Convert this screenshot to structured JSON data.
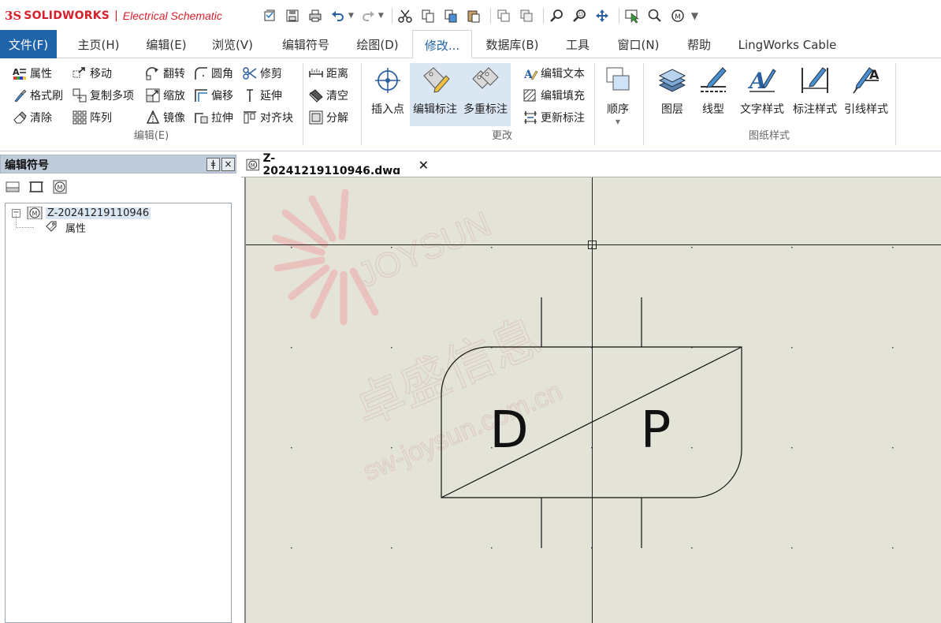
{
  "app": {
    "brand_mark": "3S",
    "brand_name": "SOLIDWORKS",
    "separator": "|",
    "product_name": "Electrical Schematic"
  },
  "quick_access": [
    {
      "name": "open-recent-icon"
    },
    {
      "name": "save-icon"
    },
    {
      "name": "print-icon"
    },
    {
      "name": "undo-icon"
    },
    {
      "name": "redo-icon"
    },
    {
      "name": "cut-icon"
    },
    {
      "name": "copy-icon"
    },
    {
      "name": "paste-format-icon"
    },
    {
      "name": "paste-icon"
    },
    {
      "name": "copy-window-icon"
    },
    {
      "name": "paste-window-icon"
    },
    {
      "name": "zoom-icon"
    },
    {
      "name": "zoom-window-icon"
    },
    {
      "name": "pan-icon"
    },
    {
      "name": "select-cursor-icon"
    },
    {
      "name": "search-icon"
    },
    {
      "name": "macro-icon"
    },
    {
      "name": "customize-dropdown-icon"
    }
  ],
  "tabs": [
    {
      "label": "文件(F)"
    },
    {
      "label": "主页(H)"
    },
    {
      "label": "编辑(E)"
    },
    {
      "label": "浏览(V)"
    },
    {
      "label": "编辑符号"
    },
    {
      "label": "绘图(D)"
    },
    {
      "label": "修改..."
    },
    {
      "label": "数据库(B)"
    },
    {
      "label": "工具"
    },
    {
      "label": "窗口(N)"
    },
    {
      "label": "帮助"
    },
    {
      "label": "LingWorks Cable"
    }
  ],
  "active_tab": "修改...",
  "ribbon": {
    "edit_group": {
      "label": "编辑(E)",
      "buttons": [
        {
          "label": "属性",
          "icon": "properties-icon"
        },
        {
          "label": "格式刷",
          "icon": "format-painter-icon"
        },
        {
          "label": "清除",
          "icon": "eraser-icon"
        },
        {
          "label": "移动",
          "icon": "move-icon"
        },
        {
          "label": "复制多项",
          "icon": "copy-multiple-icon"
        },
        {
          "label": "阵列",
          "icon": "array-icon"
        },
        {
          "label": "翻转",
          "icon": "flip-icon"
        },
        {
          "label": "缩放",
          "icon": "scale-icon"
        },
        {
          "label": "镜像",
          "icon": "mirror-icon"
        },
        {
          "label": "圆角",
          "icon": "fillet-icon"
        },
        {
          "label": "偏移",
          "icon": "offset-icon"
        },
        {
          "label": "拉伸",
          "icon": "stretch-icon"
        },
        {
          "label": "修剪",
          "icon": "trim-icon"
        },
        {
          "label": "延伸",
          "icon": "extend-icon"
        },
        {
          "label": "对齐块",
          "icon": "align-blocks-icon"
        }
      ]
    },
    "measure_group": {
      "buttons": [
        {
          "label": "距离",
          "icon": "distance-icon"
        },
        {
          "label": "清空",
          "icon": "clear-icon"
        },
        {
          "label": "分解",
          "icon": "explode-icon"
        }
      ]
    },
    "change_group": {
      "label": "更改",
      "buttons": [
        {
          "label": "插入点",
          "icon": "insert-point-icon"
        },
        {
          "label": "编辑标注",
          "icon": "edit-annotation-icon"
        },
        {
          "label": "多重标注",
          "icon": "multi-annotation-icon"
        },
        {
          "label": "编辑文本",
          "icon": "edit-text-icon"
        },
        {
          "label": "编辑填充",
          "icon": "edit-fill-icon"
        },
        {
          "label": "更新标注",
          "icon": "update-annotation-icon"
        },
        {
          "label": "顺序",
          "icon": "order-icon"
        }
      ]
    },
    "drawing_style_group": {
      "label": "图纸样式",
      "buttons": [
        {
          "label": "图层",
          "icon": "layers-icon"
        },
        {
          "label": "线型",
          "icon": "linetype-icon"
        },
        {
          "label": "文字样式",
          "icon": "text-style-icon"
        },
        {
          "label": "标注样式",
          "icon": "dimension-style-icon"
        },
        {
          "label": "引线样式",
          "icon": "leader-style-icon"
        }
      ]
    }
  },
  "left_panel": {
    "title": "编辑符号",
    "pin_label": "ǂ",
    "close_label": "×",
    "tree": {
      "root": {
        "label": "Z-20241219110946",
        "expander": "−",
        "icon": "macro-symbol-icon"
      },
      "children": [
        {
          "label": "属性",
          "icon": "tag-icon"
        }
      ]
    }
  },
  "document": {
    "tab_label": "Z-20241219110946.dwg",
    "close_label": "✕"
  },
  "symbol": {
    "left_letter": "D",
    "right_letter": "P"
  },
  "watermark": {
    "line1": "JOYSUN",
    "line2": "卓盛信息",
    "line3": "sw-joysun.com.cn"
  }
}
